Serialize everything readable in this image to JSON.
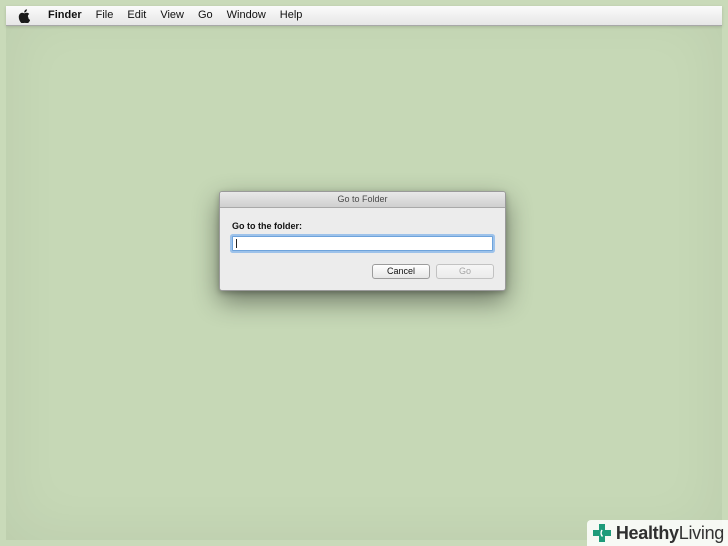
{
  "menubar": {
    "apple_icon": "apple-icon",
    "items": [
      {
        "label": "Finder"
      },
      {
        "label": "File"
      },
      {
        "label": "Edit"
      },
      {
        "label": "View"
      },
      {
        "label": "Go"
      },
      {
        "label": "Window"
      },
      {
        "label": "Help"
      }
    ]
  },
  "dialog": {
    "title": "Go to Folder",
    "prompt": "Go to the folder:",
    "input_value": "",
    "cancel_label": "Cancel",
    "go_label": "Go"
  },
  "watermark": {
    "icon": "health-plus-icon",
    "text_bold": "Healthy",
    "text_regular": "Living"
  },
  "colors": {
    "desktop": "#c9dab9",
    "focus_ring": "#9dc2ea",
    "watermark_green": "#1e9b7a"
  }
}
